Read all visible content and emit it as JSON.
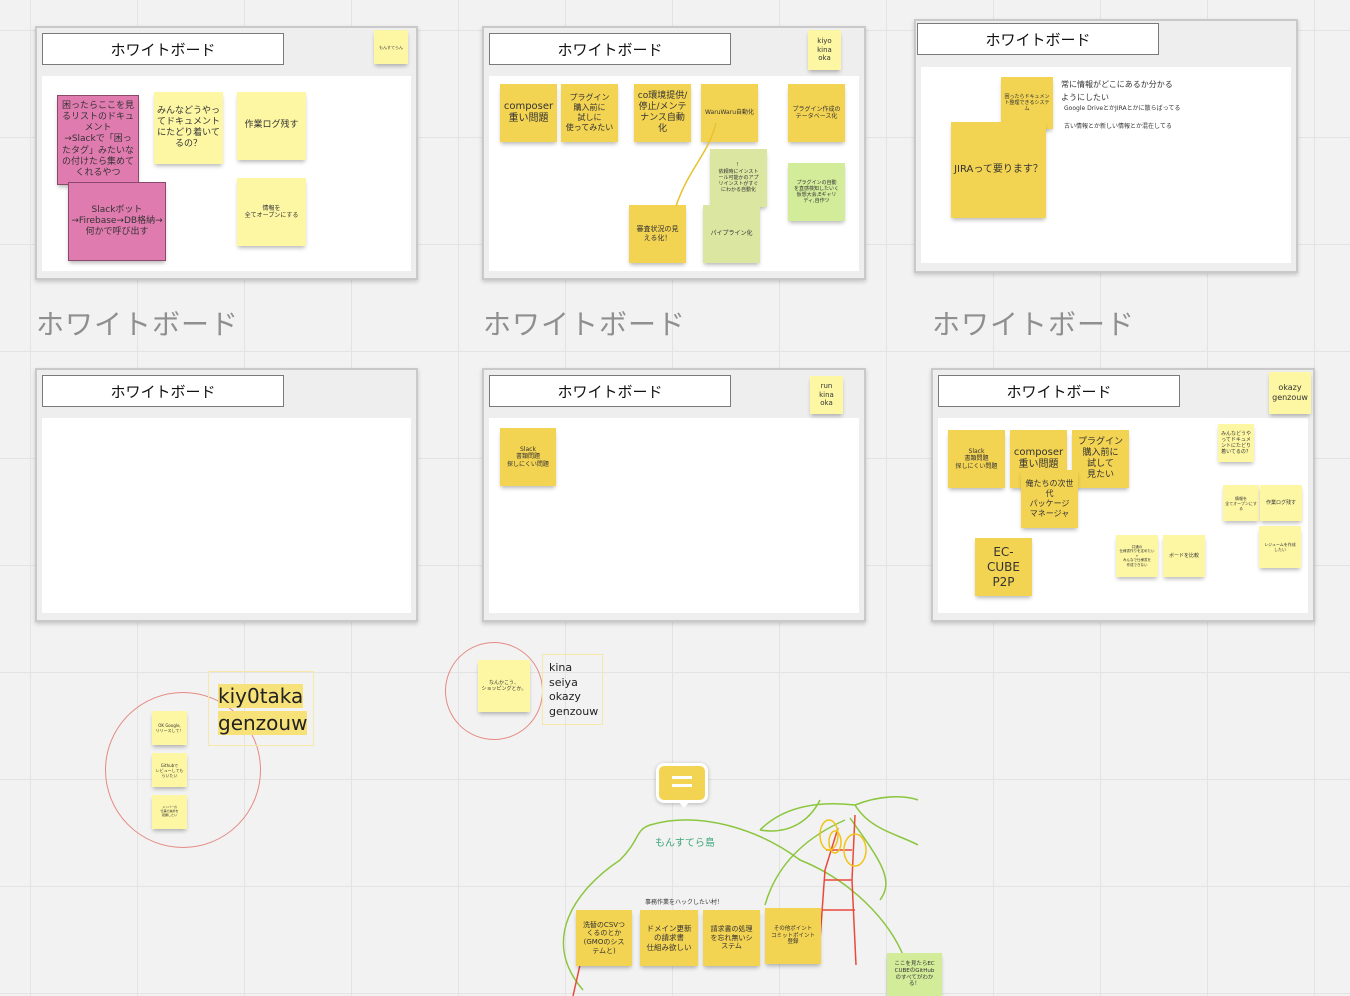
{
  "frame_title": "ホワイトボード",
  "frame_labels": [
    "ホワイトボード",
    "ホワイトボード",
    "ホワイトボード"
  ],
  "frame1": {
    "corner_note": "もんすてらん",
    "notes": [
      "困ったらここを見るリストのドキュメント\n→Slackで「困ったタグ」みたいなの付けたら集めてくれるやつ",
      "Slackボット→Firebase→DB格納→何かで呼び出す",
      "みんなどうやってドキュメントにたどり着いてるの？",
      "作業ログ残す",
      "情報を\n全てオープンにする"
    ]
  },
  "frame2": {
    "corner_note": "kiyo\nkina\noka",
    "notes": [
      "composer\n重い問題",
      "プラグイン\n購入前に\n試しに\n使ってみたい",
      "co環境提供/\n停止/メンテ\nナンス自動\n化",
      "WaruWaru自動化",
      "プラグイン作成の\nテータベース化",
      "！\n依頼時にインスト\nール可能かのアプ\nリインストがすぐ\nにわかる自動化",
      "プラグインの自動\nを直感検知したいく\n仮想大会,Eギャリ\nディ,自作ツ",
      "審査状況の見\nえる化！",
      "パイプライン化"
    ]
  },
  "frame3": {
    "notes": [
      "困ったらドキュメント整理できるシステム",
      "JIRAって要ります？"
    ],
    "text_lines": [
      "常に情報がどこにあるか分かる\nようにしたい",
      "Google DriveとかJIRAとかに散らばってる",
      "古い情報とか新しい情報とか混在してる"
    ]
  },
  "frame5": {
    "corner_note": "run\nkina\noka",
    "notes": [
      "Slack\n書類問題\n探しにくい問題"
    ]
  },
  "frame6": {
    "corner_note": "okazy\ngenzouw",
    "notes": [
      "Slack\n書類問題\n探しにくい問題",
      "composer\n重い問題",
      "プラグイン\n購入前に\n試して\n見たい",
      "俺たちの次世代\nパッケージ\nマネージャ",
      "EC-CUBE\nP2P",
      "みんなどうや\nってドキュメ\nントにたどり\n着いてるの？",
      "情報を\n全てオープンにする",
      "作業ログ残す",
      "レジュームを作成\nしたい",
      "共通の\n仕様書作りを定めたい\n+\nみんなで仕様書を\n作成できない",
      "ボードを比較"
    ]
  },
  "group1": {
    "names": "kiy0taka\ngenzouw",
    "notes": [
      "OK Google,\nリリースして！",
      "Githubで\nレビューしてもらいたい",
      "メンバーの\n仕事の進捗を\n把握したい"
    ]
  },
  "group2": {
    "names": "kina\nseiya\nokazy\ngenzouw",
    "notes": [
      "なんかこう、\nショッピングとか。"
    ]
  },
  "island": {
    "name": "もんすてら島",
    "caption": "事務作業をハックしたい村！",
    "notes": [
      "洗替のCSVつ\nくるのとか\n(GMOのシス\nテムと)",
      "ドメイン更新\nの請求書\n仕組み欲しい",
      "請求書の処理\nを忘れ無いシ\nステム",
      "その他ポイント\nコミットポイント\n登録",
      "ここを見たらEC\nCUBEのGitHub\nのすべてがわか\nる！"
    ]
  },
  "colors": {
    "accent": "#f3d352",
    "pink": "#e07bb0",
    "light": "#fdf7a4",
    "green": "#d3ec9a"
  }
}
